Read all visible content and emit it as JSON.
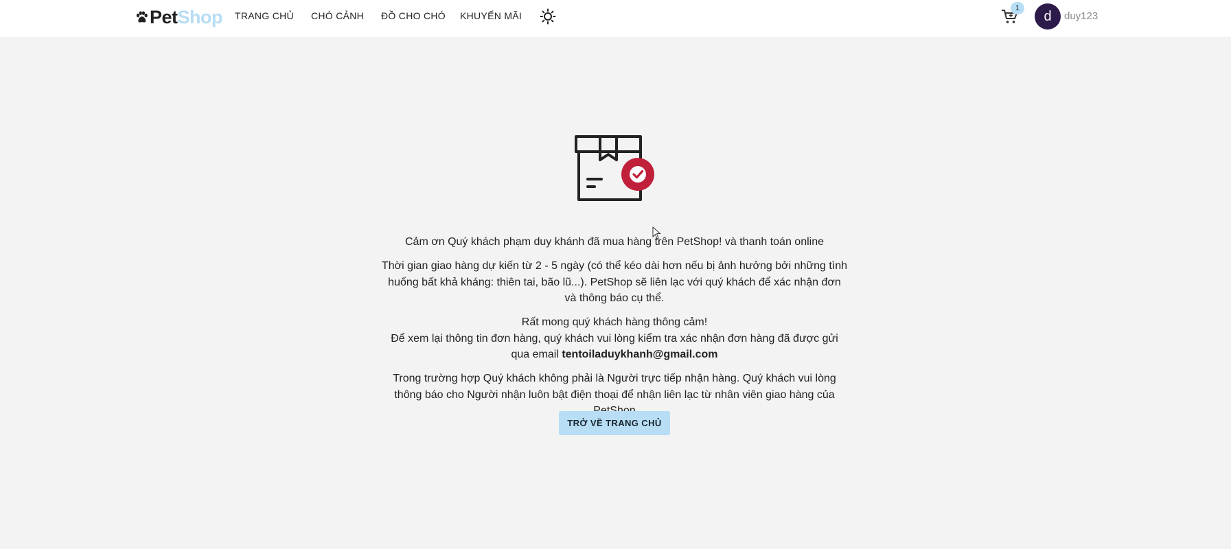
{
  "header": {
    "logo": {
      "part1": "Pet",
      "part2": "Shop"
    },
    "nav": [
      {
        "label": "TRANG CHỦ"
      },
      {
        "label": "CHÓ CẢNH"
      },
      {
        "label": "ĐỒ CHO CHÓ"
      },
      {
        "label": "KHUYẾN MÃI"
      }
    ],
    "theme_icon": "sun-icon",
    "cart": {
      "icon": "cart-icon",
      "count": "1"
    },
    "user": {
      "avatar_letter": "d",
      "username": "duy123"
    }
  },
  "confirmation": {
    "icon": "package-check-icon",
    "thank_you": "Cảm ơn Quý khách phạm duy khánh đã mua hàng trên PetShop! và thanh toán online",
    "delivery_info": "Thời gian giao hàng dự kiến từ 2 - 5 ngày (có thể kéo dài hơn nếu bị ảnh hưởng bởi những tình huống bất khả kháng: thiên tai, bão lũ...). PetShop sẽ liên lạc với quý khách để xác nhận đơn và thông báo cụ thể.",
    "apology": "Rất mong quý khách hàng thông cảm!",
    "review_info": "Để xem lại thông tin đơn hàng, quý khách vui lòng kiểm tra xác nhận đơn hàng đã được gửi qua email",
    "email": "tentoiladuykhanh@gmail.com",
    "recipient_note": "Trong trường hợp Quý khách không phải là Người trực tiếp nhận hàng. Quý khách vui lòng thông báo cho Người nhận luôn bật điện thoại để nhận liên lạc từ nhân viên giao hàng của PetShop",
    "button_label": "TRỞ VỀ TRANG CHỦ"
  },
  "colors": {
    "accent": "#b7def4",
    "check_red": "#c0203a",
    "avatar_bg": "#2c1a4a",
    "page_bg": "#f3f3f3"
  }
}
